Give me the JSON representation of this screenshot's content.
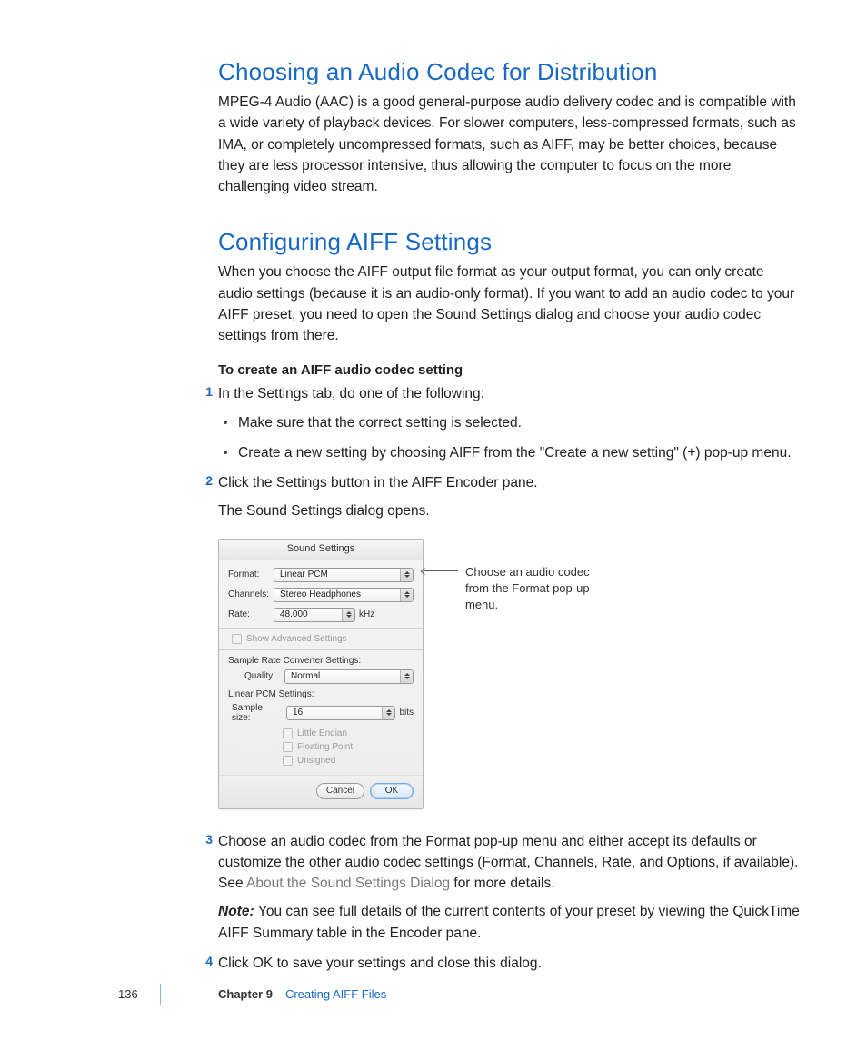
{
  "section1": {
    "heading": "Choosing an Audio Codec for Distribution",
    "body": "MPEG-4 Audio (AAC) is a good general-purpose audio delivery codec and is compatible with a wide variety of playback devices. For slower computers, less-compressed formats, such as IMA, or completely uncompressed formats, such as AIFF, may be better choices, because they are less processor intensive, thus allowing the computer to focus on the more challenging video stream."
  },
  "section2": {
    "heading": "Configuring AIFF Settings",
    "body": "When you choose the AIFF output file format as your output format, you can only create audio settings (because it is an audio-only format). If you want to add an audio codec to your AIFF preset, you need to open the Sound Settings dialog and choose your audio codec settings from there.",
    "procedure_title": "To create an AIFF audio codec setting"
  },
  "steps": {
    "s1": {
      "num": "1",
      "text": "In the Settings tab, do one of the following:",
      "b1": "Make sure that the correct setting is selected.",
      "b2": "Create a new setting by choosing AIFF from the \"Create a new setting\" (+) pop-up menu."
    },
    "s2": {
      "num": "2",
      "text": "Click the Settings button in the AIFF Encoder pane.",
      "after": "The Sound Settings dialog opens."
    },
    "s3": {
      "num": "3",
      "text_a": "Choose an audio codec from the Format pop-up menu and either accept its defaults or customize the other audio codec settings (Format, Channels, Rate, and Options, if available). See ",
      "link": "About the Sound Settings Dialog",
      "text_b": " for more details.",
      "note_label": "Note:  ",
      "note": "You can see full details of the current contents of your preset by viewing the QuickTime AIFF Summary table in the Encoder pane."
    },
    "s4": {
      "num": "4",
      "text": "Click OK to save your settings and close this dialog."
    }
  },
  "dialog": {
    "title": "Sound Settings",
    "format_label": "Format:",
    "format_value": "Linear PCM",
    "channels_label": "Channels:",
    "channels_value": "Stereo Headphones",
    "rate_label": "Rate:",
    "rate_value": "48.000",
    "rate_unit": "kHz",
    "show_advanced": "Show Advanced Settings",
    "src_settings": "Sample Rate Converter Settings:",
    "quality_label": "Quality:",
    "quality_value": "Normal",
    "lpcm_settings": "Linear PCM Settings:",
    "sample_size_label": "Sample size:",
    "sample_size_value": "16",
    "sample_size_unit": "bits",
    "little_endian": "Little Endian",
    "floating_point": "Floating Point",
    "unsigned": "Unsigned",
    "cancel": "Cancel",
    "ok": "OK"
  },
  "callout": {
    "text": "Choose an audio codec from the Format pop-up menu."
  },
  "footer": {
    "page": "136",
    "chapter_num": "Chapter 9",
    "chapter_title": "Creating AIFF Files"
  }
}
